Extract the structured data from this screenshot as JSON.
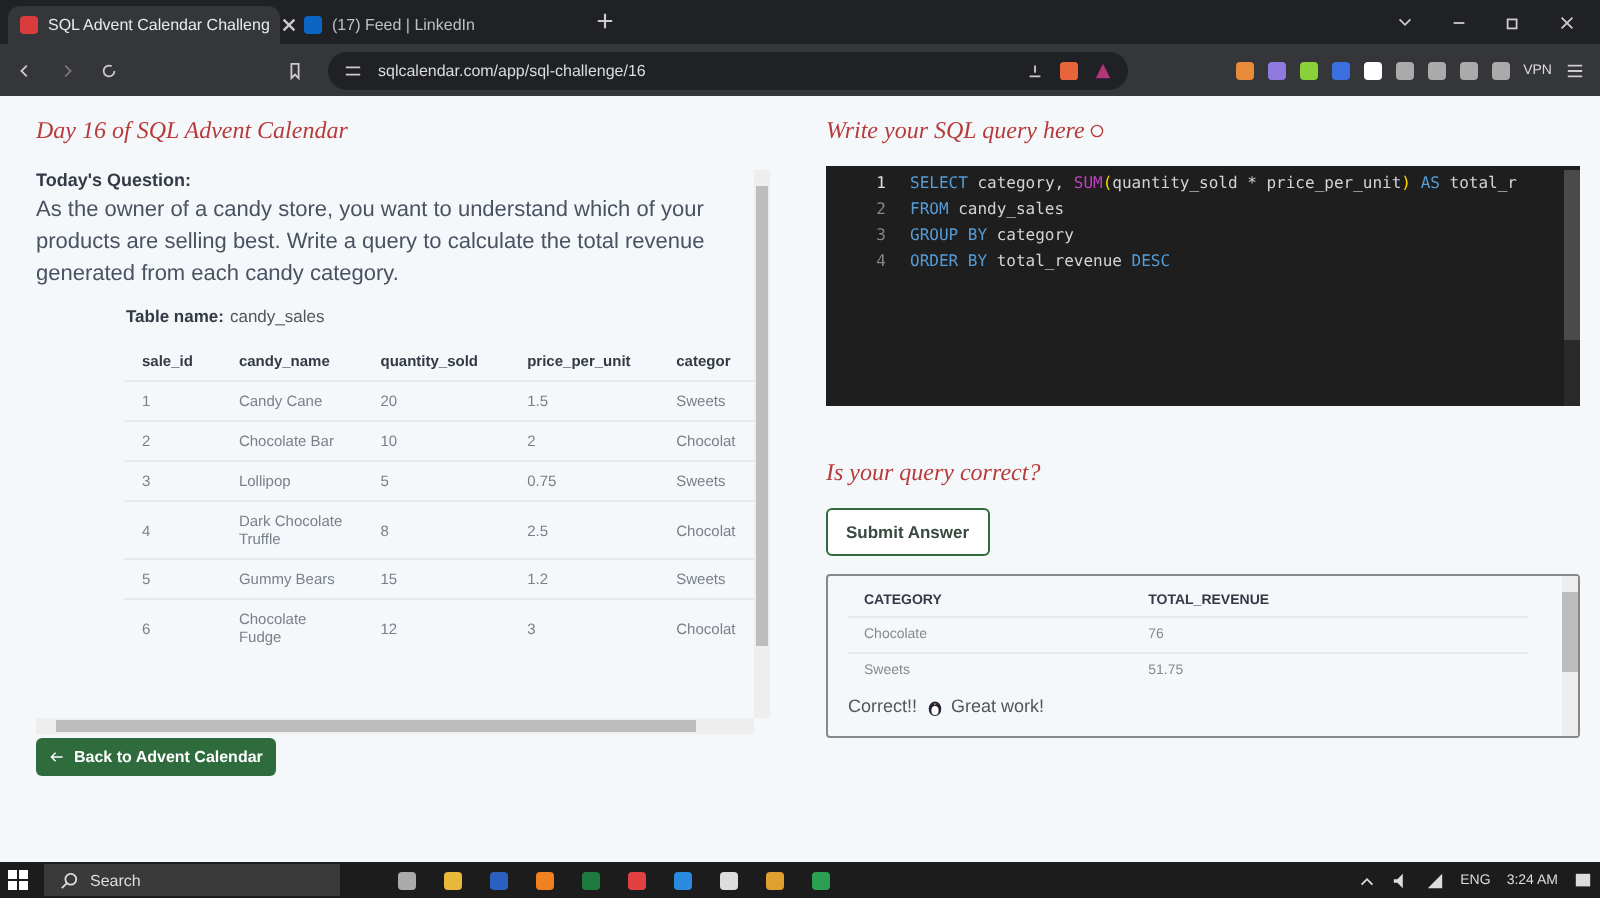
{
  "browser": {
    "tabs": [
      {
        "title": "SQL Advent Calendar Challeng",
        "selected": true,
        "kind": "candy"
      },
      {
        "title": "(17) Feed | LinkedIn",
        "selected": false,
        "kind": "linkedin"
      }
    ],
    "url": "sqlcalendar.com/app/sql-challenge/16",
    "vpn": "VPN"
  },
  "left": {
    "title": "Day 16 of SQL Advent Calendar",
    "question_label": "Today's Question:",
    "question": "As the owner of a candy store, you want to understand which of your products are selling best. Write a query to calculate the total revenue generated from each candy category.",
    "table_name_label": "Table name:",
    "table_name": "candy_sales",
    "columns": [
      "sale_id",
      "candy_name",
      "quantity_sold",
      "price_per_unit",
      "categor"
    ],
    "rows": [
      [
        "1",
        "Candy Cane",
        "20",
        "1.5",
        "Sweets"
      ],
      [
        "2",
        "Chocolate Bar",
        "10",
        "2",
        "Chocolat"
      ],
      [
        "3",
        "Lollipop",
        "5",
        "0.75",
        "Sweets"
      ],
      [
        "4",
        "Dark Chocolate Truffle",
        "8",
        "2.5",
        "Chocolat"
      ],
      [
        "5",
        "Gummy Bears",
        "15",
        "1.2",
        "Sweets"
      ],
      [
        "6",
        "Chocolate Fudge",
        "12",
        "3",
        "Chocolat"
      ]
    ],
    "back_button": "Back to Advent Calendar"
  },
  "right": {
    "title": "Write your SQL query here",
    "lines": [
      {
        "number": "1",
        "active": true,
        "tokens": [
          {
            "kind": "keyword",
            "text": "SELECT"
          },
          {
            "kind": "plain",
            "text": " category, "
          },
          {
            "kind": "function",
            "text": "SUM"
          },
          {
            "kind": "paren",
            "text": "("
          },
          {
            "kind": "plain",
            "text": "quantity_sold * price_per_unit"
          },
          {
            "kind": "paren",
            "text": ")"
          },
          {
            "kind": "keyword",
            "text": " AS"
          },
          {
            "kind": "plain",
            "text": " total_r"
          }
        ]
      },
      {
        "number": "2",
        "active": false,
        "tokens": [
          {
            "kind": "keyword",
            "text": "FROM"
          },
          {
            "kind": "plain",
            "text": " candy_sales"
          }
        ]
      },
      {
        "number": "3",
        "active": false,
        "tokens": [
          {
            "kind": "keyword",
            "text": "GROUP BY"
          },
          {
            "kind": "plain",
            "text": " category"
          }
        ]
      },
      {
        "number": "4",
        "active": false,
        "tokens": [
          {
            "kind": "keyword",
            "text": "ORDER BY"
          },
          {
            "kind": "plain",
            "text": " total_revenue "
          },
          {
            "kind": "keyword",
            "text": "DESC"
          }
        ]
      }
    ],
    "check_title": "Is your query correct?",
    "submit_button": "Submit Answer",
    "result_columns": [
      "CATEGORY",
      "TOTAL_REVENUE"
    ],
    "result_rows": [
      [
        "Chocolate",
        "76"
      ],
      [
        "Sweets",
        "51.75"
      ]
    ],
    "message_start": "Correct!!",
    "message_end": "Great work!"
  },
  "taskbar": {
    "search": "Search",
    "language": "ENG",
    "time": "3:24 AM"
  }
}
